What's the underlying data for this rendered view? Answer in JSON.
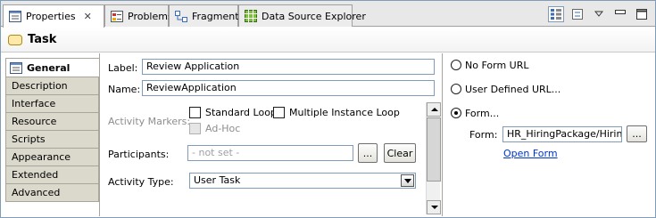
{
  "tabs": [
    {
      "label": "Properties",
      "icon": "properties-icon",
      "active": true
    },
    {
      "label": "Problems",
      "icon": "problems-icon"
    },
    {
      "label": "Fragments",
      "icon": "fragments-icon"
    },
    {
      "label": "Data Source Explorer",
      "icon": "data-source-icon"
    }
  ],
  "title": "Task",
  "nav": [
    "General",
    "Description",
    "Interface",
    "Resource",
    "Scripts",
    "Appearance",
    "Extended",
    "Advanced"
  ],
  "general": {
    "label_caption": "Label:",
    "label_value": "Review Application",
    "name_caption": "Name:",
    "name_value": "ReviewApplication",
    "markers_caption": "Activity Markers:",
    "standard_loop": "Standard Loop",
    "multi_loop": "Multiple Instance Loop",
    "adhoc": "Ad-Hoc",
    "participants_caption": "Participants:",
    "participants_placeholder": "- not set -",
    "browse_label": "...",
    "clear_label": "Clear",
    "activity_type_caption": "Activity Type:",
    "activity_type_value": "User Task"
  },
  "form": {
    "no_url": "No Form URL",
    "user_defined": "User Defined URL...",
    "form": "Form...",
    "form_caption": "Form:",
    "form_value": "HR_HiringPackage/HiringPr",
    "browse_label": "...",
    "open_form": "Open Form"
  },
  "colors": {
    "accent": "#0033cc",
    "tab_bg": "#e8e8e8",
    "nav_bg": "#dbd8cc"
  }
}
